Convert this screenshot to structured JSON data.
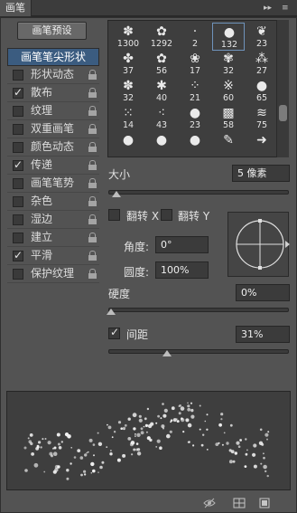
{
  "panel": {
    "tab_title": "画笔",
    "menu_arrows": "▸▸",
    "menu_icon": "≡"
  },
  "preset_button": "画笔预设",
  "sidebar": [
    {
      "label": "画笔笔尖形状",
      "selected": true,
      "checkbox": false
    },
    {
      "label": "形状动态",
      "checked": false,
      "checkbox": true,
      "lock": true
    },
    {
      "label": "散布",
      "checked": true,
      "checkbox": true,
      "lock": true
    },
    {
      "label": "纹理",
      "checked": false,
      "checkbox": true,
      "lock": true
    },
    {
      "label": "双重画笔",
      "checked": false,
      "checkbox": true,
      "lock": true
    },
    {
      "label": "颜色动态",
      "checked": false,
      "checkbox": true,
      "lock": true
    },
    {
      "label": "传递",
      "checked": true,
      "checkbox": true,
      "lock": true
    },
    {
      "label": "画笔笔势",
      "checked": false,
      "checkbox": true,
      "lock": true
    },
    {
      "label": "杂色",
      "checked": false,
      "checkbox": true,
      "lock": true
    },
    {
      "label": "湿边",
      "checked": false,
      "checkbox": true,
      "lock": true
    },
    {
      "label": "建立",
      "checked": false,
      "checkbox": true,
      "lock": true
    },
    {
      "label": "平滑",
      "checked": true,
      "checkbox": true,
      "lock": true
    },
    {
      "label": "保护纹理",
      "checked": false,
      "checkbox": true,
      "lock": true
    }
  ],
  "brush_tips": [
    {
      "size": "1300",
      "icon": "splatter-icon",
      "glyph": "✽"
    },
    {
      "size": "1292",
      "icon": "leaf-icon",
      "glyph": "✿"
    },
    {
      "size": "2",
      "icon": "dot-icon",
      "glyph": "·"
    },
    {
      "size": "132",
      "icon": "soft-round-icon",
      "glyph": "●",
      "selected": true
    },
    {
      "size": "23",
      "icon": "leaf-icon",
      "glyph": "❦"
    },
    {
      "size": "37",
      "icon": "leaf-icon",
      "glyph": "✤"
    },
    {
      "size": "56",
      "icon": "leaf-icon",
      "glyph": "✿"
    },
    {
      "size": "17",
      "icon": "leaf-icon",
      "glyph": "❀"
    },
    {
      "size": "32",
      "icon": "leaf-icon",
      "glyph": "✾"
    },
    {
      "size": "27",
      "icon": "grass-icon",
      "glyph": "⁂"
    },
    {
      "size": "32",
      "icon": "leaf-icon",
      "glyph": "✽"
    },
    {
      "size": "40",
      "icon": "star-icon",
      "glyph": "✱"
    },
    {
      "size": "21",
      "icon": "texture-icon",
      "glyph": "⁘"
    },
    {
      "size": "60",
      "icon": "texture-icon",
      "glyph": "※"
    },
    {
      "size": "65",
      "icon": "soft-round-icon",
      "glyph": "●"
    },
    {
      "size": "14",
      "icon": "texture-icon",
      "glyph": "⁙"
    },
    {
      "size": "43",
      "icon": "texture-icon",
      "glyph": "⁖"
    },
    {
      "size": "23",
      "icon": "soft-round-icon",
      "glyph": "●"
    },
    {
      "size": "58",
      "icon": "texture-icon",
      "glyph": "▩"
    },
    {
      "size": "75",
      "icon": "grass-icon",
      "glyph": "≋"
    },
    {
      "size": "",
      "icon": "soft-round-icon",
      "glyph": "●"
    },
    {
      "size": "",
      "icon": "soft-round-icon",
      "glyph": "●"
    },
    {
      "size": "",
      "icon": "soft-round-icon",
      "glyph": "●"
    },
    {
      "size": "",
      "icon": "pencil-icon",
      "glyph": "✎"
    },
    {
      "size": "",
      "icon": "arrow-icon",
      "glyph": "➜"
    }
  ],
  "size": {
    "label": "大小",
    "value": "5 像素",
    "fraction": 0.03
  },
  "flip_x": {
    "label": "翻转 X",
    "checked": false
  },
  "flip_y": {
    "label": "翻转 Y",
    "checked": false
  },
  "angle": {
    "label": "角度:",
    "value": "0°"
  },
  "roundness": {
    "label": "圆度:",
    "value": "100%"
  },
  "hardness": {
    "label": "硬度",
    "value": "0%",
    "fraction": 0.0
  },
  "spacing": {
    "label": "间距",
    "value": "31%",
    "checked": true,
    "fraction": 0.31
  },
  "footer": {
    "eye_icon": "eye-icon",
    "grid_icon": "grid-icon",
    "new_icon": "new-preset-icon"
  }
}
